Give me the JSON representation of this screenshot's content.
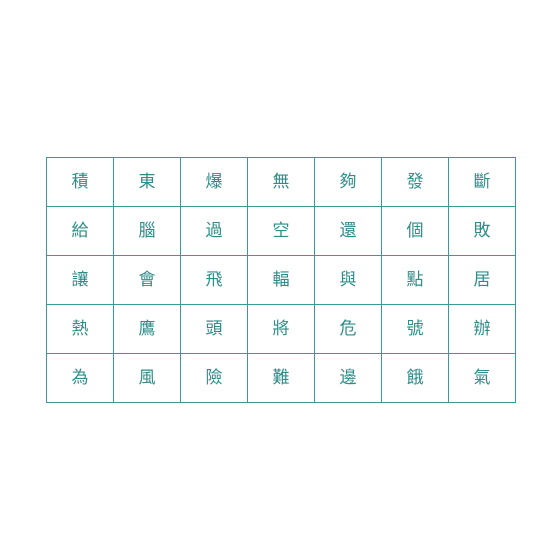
{
  "grid": {
    "rows": [
      [
        "積",
        "東",
        "爆",
        "無",
        "夠",
        "發",
        "斷"
      ],
      [
        "給",
        "腦",
        "過",
        "空",
        "還",
        "個",
        "敗"
      ],
      [
        "讓",
        "會",
        "飛",
        "輻",
        "與",
        "點",
        "居"
      ],
      [
        "熱",
        "鷹",
        "頭",
        "將",
        "危",
        "號",
        "辦"
      ],
      [
        "為",
        "風",
        "險",
        "難",
        "邊",
        "餓",
        "氣"
      ]
    ]
  },
  "colors": {
    "border": "#3a9a96",
    "text": "#2f8d89",
    "background": "#ffffff"
  }
}
